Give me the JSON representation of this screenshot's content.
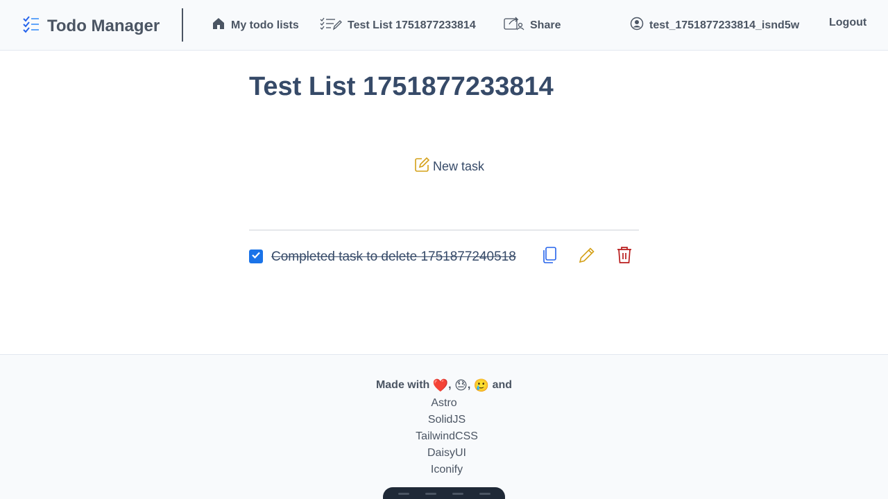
{
  "header": {
    "brand": "Todo Manager",
    "nav": {
      "home": "My todo lists",
      "list": "Test List 1751877233814",
      "share": "Share",
      "user": "test_1751877233814_isnd5w",
      "logout": "Logout"
    }
  },
  "main": {
    "title": "Test List 1751877233814",
    "new_task": "New task",
    "tasks": [
      {
        "text": "Completed task to delete 1751877240518",
        "completed": true
      }
    ]
  },
  "footer": {
    "made_with_prefix": "Made with",
    "made_with_suffix": "and",
    "emojis": [
      "❤️",
      "😓",
      "🥲"
    ],
    "tech": [
      "Astro",
      "SolidJS",
      "TailwindCSS",
      "DaisyUI",
      "Iconify"
    ]
  },
  "colors": {
    "accent": "#1a73e8",
    "title": "#364a68",
    "edit": "#d4a017",
    "delete": "#b91c1c",
    "copy": "#2563eb"
  },
  "icons": [
    "list-check-icon",
    "home-icon",
    "list-edit-icon",
    "share-icon",
    "user-circle-icon",
    "edit-square-icon",
    "check-icon",
    "copy-icon",
    "pencil-icon",
    "trash-icon"
  ]
}
